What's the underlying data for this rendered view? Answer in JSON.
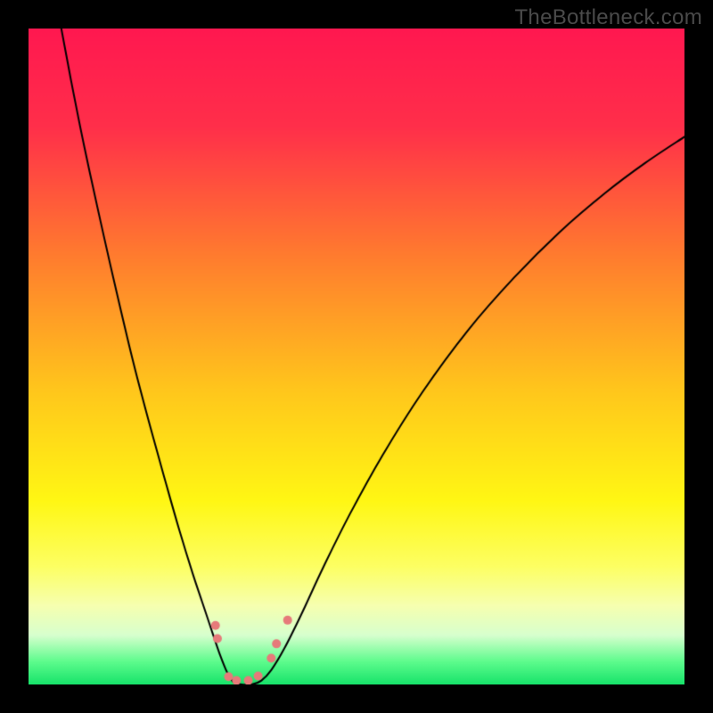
{
  "watermark": "TheBottleneck.com",
  "chart_data": {
    "type": "line",
    "title": "",
    "xlabel": "",
    "ylabel": "",
    "xlim": [
      0,
      100
    ],
    "ylim": [
      0,
      100
    ],
    "grid": false,
    "legend": false,
    "background_gradient": {
      "stops": [
        {
          "pos": 0.0,
          "color": "#ff1850"
        },
        {
          "pos": 0.15,
          "color": "#ff2f4a"
        },
        {
          "pos": 0.35,
          "color": "#ff7d2e"
        },
        {
          "pos": 0.55,
          "color": "#ffc61c"
        },
        {
          "pos": 0.72,
          "color": "#fff714"
        },
        {
          "pos": 0.82,
          "color": "#fdff63"
        },
        {
          "pos": 0.88,
          "color": "#f6ffb0"
        },
        {
          "pos": 0.925,
          "color": "#d7ffce"
        },
        {
          "pos": 0.965,
          "color": "#5efc8d"
        },
        {
          "pos": 1.0,
          "color": "#17e36a"
        }
      ]
    },
    "series": [
      {
        "name": "left-arm",
        "color": "#000000",
        "width": 2,
        "points": [
          {
            "x": 5.0,
            "y": 100.0
          },
          {
            "x": 6.5,
            "y": 92.0
          },
          {
            "x": 8.5,
            "y": 82.0
          },
          {
            "x": 11.0,
            "y": 70.5
          },
          {
            "x": 13.5,
            "y": 59.5
          },
          {
            "x": 16.0,
            "y": 49.0
          },
          {
            "x": 18.5,
            "y": 39.5
          },
          {
            "x": 21.0,
            "y": 30.5
          },
          {
            "x": 23.0,
            "y": 23.5
          },
          {
            "x": 25.0,
            "y": 17.0
          },
          {
            "x": 26.5,
            "y": 12.5
          },
          {
            "x": 28.0,
            "y": 8.0
          },
          {
            "x": 29.2,
            "y": 4.5
          },
          {
            "x": 30.3,
            "y": 1.8
          },
          {
            "x": 31.3,
            "y": 0.3
          },
          {
            "x": 32.5,
            "y": 0.0
          }
        ]
      },
      {
        "name": "right-arm",
        "color": "#000000",
        "width": 2,
        "points": [
          {
            "x": 32.5,
            "y": 0.0
          },
          {
            "x": 34.0,
            "y": 0.0
          },
          {
            "x": 35.5,
            "y": 0.6
          },
          {
            "x": 37.0,
            "y": 2.2
          },
          {
            "x": 39.0,
            "y": 5.5
          },
          {
            "x": 41.5,
            "y": 10.5
          },
          {
            "x": 45.0,
            "y": 18.0
          },
          {
            "x": 49.0,
            "y": 26.0
          },
          {
            "x": 54.0,
            "y": 35.0
          },
          {
            "x": 60.0,
            "y": 44.5
          },
          {
            "x": 67.0,
            "y": 54.0
          },
          {
            "x": 74.0,
            "y": 62.0
          },
          {
            "x": 81.0,
            "y": 69.0
          },
          {
            "x": 88.0,
            "y": 75.0
          },
          {
            "x": 94.0,
            "y": 79.5
          },
          {
            "x": 100.0,
            "y": 83.5
          }
        ]
      }
    ],
    "markers": [
      {
        "shape": "circle",
        "x": 28.5,
        "y": 9.0,
        "r": 5,
        "color": "#e67a7a"
      },
      {
        "shape": "circle",
        "x": 28.8,
        "y": 7.0,
        "r": 5,
        "color": "#e67a7a"
      },
      {
        "shape": "circle",
        "x": 30.5,
        "y": 1.2,
        "r": 5,
        "color": "#e67a7a"
      },
      {
        "shape": "circle",
        "x": 31.7,
        "y": 0.6,
        "r": 5,
        "color": "#e67a7a"
      },
      {
        "shape": "circle",
        "x": 33.5,
        "y": 0.6,
        "r": 5,
        "color": "#e67a7a"
      },
      {
        "shape": "circle",
        "x": 35.0,
        "y": 1.3,
        "r": 5,
        "color": "#e67a7a"
      },
      {
        "shape": "circle",
        "x": 37.0,
        "y": 4.0,
        "r": 5,
        "color": "#e67a7a"
      },
      {
        "shape": "circle",
        "x": 37.8,
        "y": 6.2,
        "r": 5,
        "color": "#e67a7a"
      },
      {
        "shape": "circle",
        "x": 39.5,
        "y": 9.8,
        "r": 5,
        "color": "#e67a7a"
      }
    ]
  }
}
